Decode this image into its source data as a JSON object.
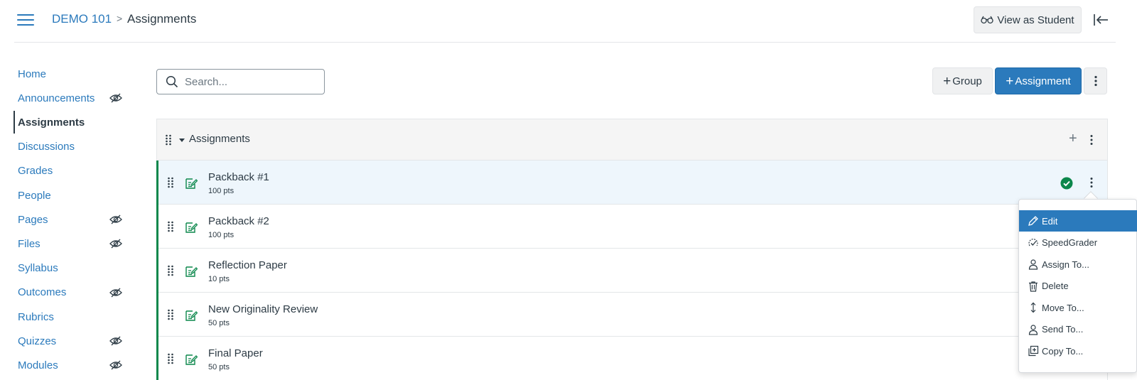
{
  "header": {
    "course": "DEMO 101",
    "separator": ">",
    "current": "Assignments",
    "view_as_student": "View as Student"
  },
  "sidebar": {
    "items": [
      {
        "label": "Home",
        "hidden": false,
        "active": false
      },
      {
        "label": "Announcements",
        "hidden": true,
        "active": false
      },
      {
        "label": "Assignments",
        "hidden": false,
        "active": true
      },
      {
        "label": "Discussions",
        "hidden": false,
        "active": false
      },
      {
        "label": "Grades",
        "hidden": false,
        "active": false
      },
      {
        "label": "People",
        "hidden": false,
        "active": false
      },
      {
        "label": "Pages",
        "hidden": true,
        "active": false
      },
      {
        "label": "Files",
        "hidden": true,
        "active": false
      },
      {
        "label": "Syllabus",
        "hidden": false,
        "active": false
      },
      {
        "label": "Outcomes",
        "hidden": true,
        "active": false
      },
      {
        "label": "Rubrics",
        "hidden": false,
        "active": false
      },
      {
        "label": "Quizzes",
        "hidden": true,
        "active": false
      },
      {
        "label": "Modules",
        "hidden": true,
        "active": false
      }
    ]
  },
  "toolbar": {
    "search_placeholder": "Search...",
    "group_label": "Group",
    "assignment_label": "Assignment"
  },
  "group": {
    "title": "Assignments",
    "assignments": [
      {
        "title": "Packback #1",
        "points": "100 pts",
        "published": true
      },
      {
        "title": "Packback #2",
        "points": "100 pts",
        "published": true
      },
      {
        "title": "Reflection Paper",
        "points": "10 pts",
        "published": true
      },
      {
        "title": "New Originality Review",
        "points": "50 pts",
        "published": true
      },
      {
        "title": "Final Paper",
        "points": "50 pts",
        "published": true
      }
    ]
  },
  "menu": {
    "items": [
      {
        "label": "Edit",
        "icon": "pencil-icon",
        "selected": true
      },
      {
        "label": "SpeedGrader",
        "icon": "speedgrader-icon",
        "selected": false
      },
      {
        "label": "Assign To...",
        "icon": "user-icon",
        "selected": false
      },
      {
        "label": "Delete",
        "icon": "trash-icon",
        "selected": false
      },
      {
        "label": "Move To...",
        "icon": "move-icon",
        "selected": false
      },
      {
        "label": "Send To...",
        "icon": "user-icon",
        "selected": false
      },
      {
        "label": "Copy To...",
        "icon": "copy-icon",
        "selected": false
      }
    ]
  },
  "colors": {
    "link_blue": "#2b7abc",
    "primary_button": "#2b7abc",
    "published_green": "#0b874b",
    "text": "#2d3b45"
  }
}
